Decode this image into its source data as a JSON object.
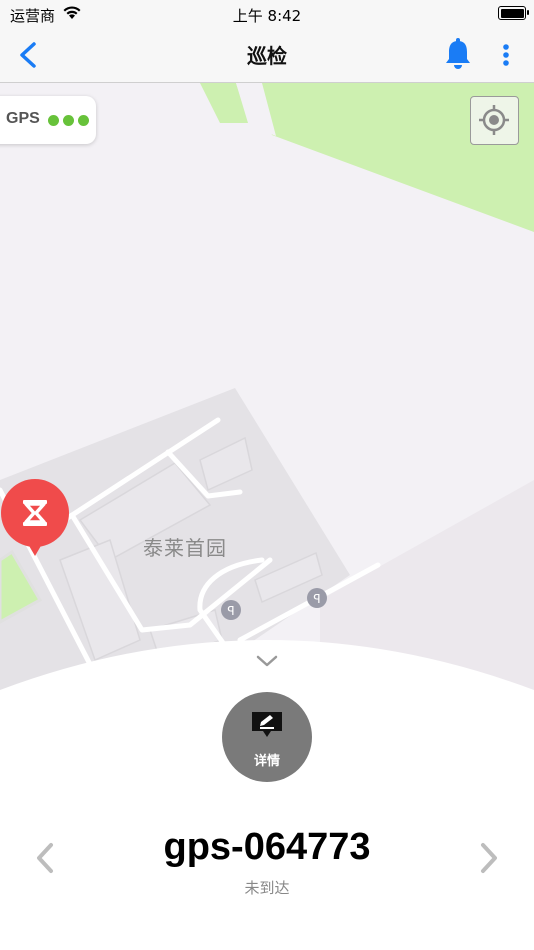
{
  "status_bar": {
    "carrier": "运营商",
    "time": "上午 8:42"
  },
  "nav": {
    "title": "巡检"
  },
  "map": {
    "gps_label": "GPS",
    "gps_signal_level": 3,
    "gps_dot_color": "#67c23a",
    "place_label": "泰莱首园",
    "marker_color": "#f04b4b",
    "park_color": "#cdf0b0"
  },
  "sheet": {
    "details_label": "详情",
    "point_name": "gps-064773",
    "point_status": "未到达"
  },
  "colors": {
    "accent": "#1a7cf5"
  }
}
